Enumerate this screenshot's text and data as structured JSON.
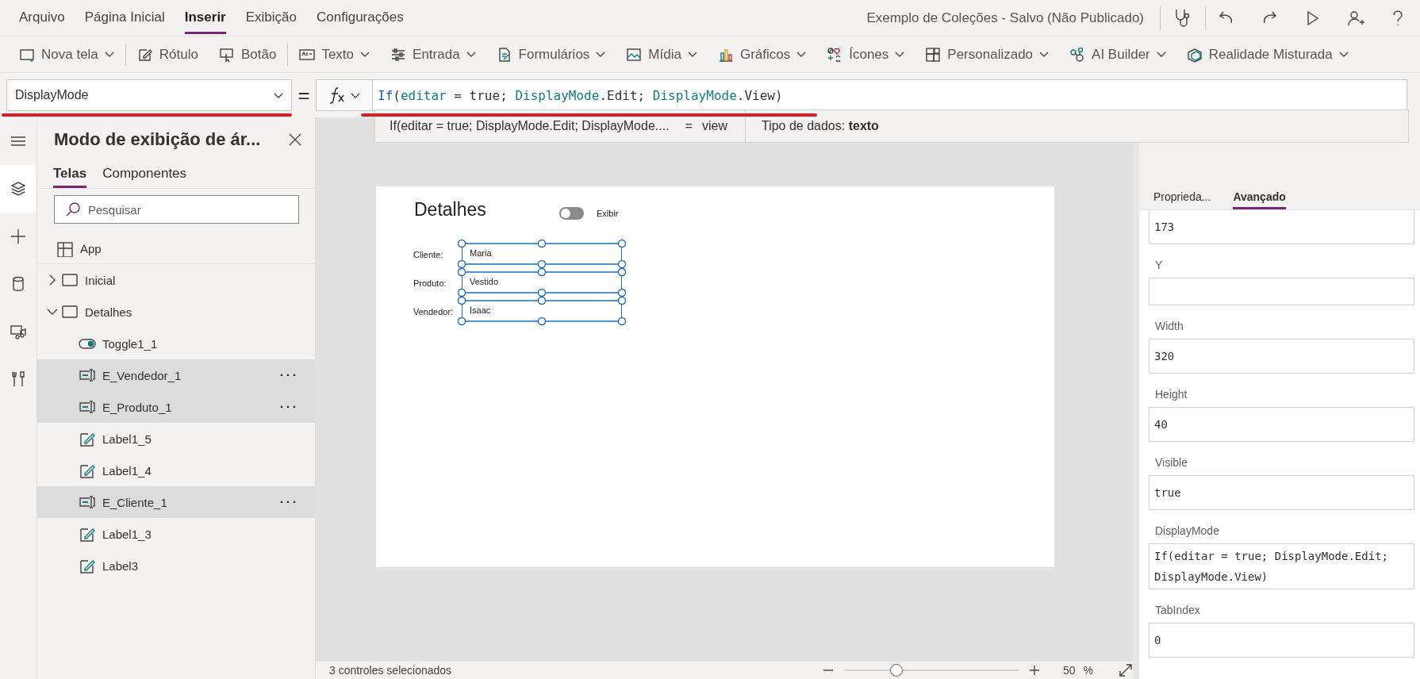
{
  "menu": {
    "tabs": [
      {
        "label": "Arquivo",
        "selected": false
      },
      {
        "label": "Página Inicial",
        "selected": false
      },
      {
        "label": "Inserir",
        "selected": true
      },
      {
        "label": "Exibição",
        "selected": false
      },
      {
        "label": "Configurações",
        "selected": false
      }
    ],
    "app_title": "Exemplo de Coleções - Salvo (Não Publicado)"
  },
  "toolbar": [
    [
      {
        "label": "Nova tela",
        "has_menu": true
      }
    ],
    [
      {
        "label": "Rótulo",
        "has_menu": false
      },
      {
        "label": "Botão",
        "has_menu": false
      }
    ],
    [
      {
        "label": "Texto",
        "has_menu": true
      },
      {
        "label": "Entrada",
        "has_menu": true
      },
      {
        "label": "Formulários",
        "has_menu": true
      },
      {
        "label": "Mídia",
        "has_menu": true
      },
      {
        "label": "Gráficos",
        "has_menu": true
      },
      {
        "label": "Ícones",
        "has_menu": true
      },
      {
        "label": "Personalizado",
        "has_menu": true
      },
      {
        "label": "AI Builder",
        "has_menu": true
      },
      {
        "label": "Realidade Misturada",
        "has_menu": true
      }
    ]
  ],
  "formula_bar": {
    "property": "DisplayMode",
    "equals": "=",
    "property_underlined": true,
    "formula_underlined": true,
    "formula": [
      {
        "text": "If",
        "kind": "function"
      },
      {
        "text": "(",
        "kind": "plain"
      },
      {
        "text": "editar",
        "kind": "variable"
      },
      {
        "text": " = true; ",
        "kind": "plain"
      },
      {
        "text": "DisplayMode",
        "kind": "enum"
      },
      {
        "text": ".Edit; ",
        "kind": "plain"
      },
      {
        "text": "DisplayMode",
        "kind": "enum"
      },
      {
        "text": ".View)",
        "kind": "plain"
      }
    ],
    "hint": {
      "expression": "If(editar = true; DisplayMode.Edit; DisplayMode....",
      "equals": "=",
      "result": "view",
      "type": "Tipo de dados: **texto**"
    }
  },
  "rail": [
    {
      "selected": false
    },
    {
      "selected": true
    },
    {
      "selected": false
    },
    {
      "selected": false
    },
    {
      "selected": false
    },
    {
      "selected": false
    }
  ],
  "tree_panel": {
    "title": "Modo de exibição de ár...",
    "tabs": [
      {
        "label": "Telas",
        "selected": true
      },
      {
        "label": "Componentes",
        "selected": false
      }
    ],
    "search": {
      "placeholder": "Pesquisar"
    },
    "items": [
      {
        "label": "App",
        "kind": "app",
        "selected": false
      },
      {
        "label": "Inicial",
        "kind": "screen",
        "expanded": false,
        "selected": false
      },
      {
        "label": "Detalhes",
        "kind": "screen",
        "expanded": true,
        "selected": false,
        "children": [
          {
            "label": "Toggle1_1",
            "kind": "toggle",
            "selected": false
          },
          {
            "label": "E_Vendedor_1",
            "kind": "textinput",
            "selected": true
          },
          {
            "label": "E_Produto_1",
            "kind": "textinput",
            "selected": true
          },
          {
            "label": "Label1_5",
            "kind": "label",
            "selected": false
          },
          {
            "label": "Label1_4",
            "kind": "label",
            "selected": false
          },
          {
            "label": "E_Cliente_1",
            "kind": "textinput",
            "selected": true
          },
          {
            "label": "Label1_3",
            "kind": "label",
            "selected": false
          },
          {
            "label": "Label3",
            "kind": "label",
            "selected": false
          }
        ]
      }
    ]
  },
  "canvas": {
    "title": "Detalhes",
    "toggle": {
      "on": false
    },
    "toggle_label": "Exibir",
    "fields": [
      {
        "label": "Cliente:",
        "value": "Maria",
        "selected": true
      },
      {
        "label": "Produto:",
        "value": "Vestido",
        "selected": true
      },
      {
        "label": "Vendedor:",
        "value": "Isaac",
        "selected": true
      }
    ]
  },
  "status_bar": {
    "selection": "3 controles selecionados",
    "zoom": {
      "level": 0.3,
      "value": "50",
      "unit": "%"
    }
  },
  "properties": {
    "tabs": [
      {
        "label": "Proprieda...",
        "selected": false
      },
      {
        "label": "Avançado",
        "selected": true
      }
    ],
    "fields": [
      {
        "value": "173"
      },
      {
        "label": "Y"
      },
      {
        "label": "Width",
        "value": "320"
      },
      {
        "label": "Height",
        "value": "40"
      },
      {
        "label": "Visible",
        "value": "true"
      },
      {
        "label": "DisplayMode",
        "value": "If(editar = true; DisplayMode.Edit; DisplayMode.View)"
      },
      {
        "label": "TabIndex",
        "value": "0"
      }
    ]
  }
}
